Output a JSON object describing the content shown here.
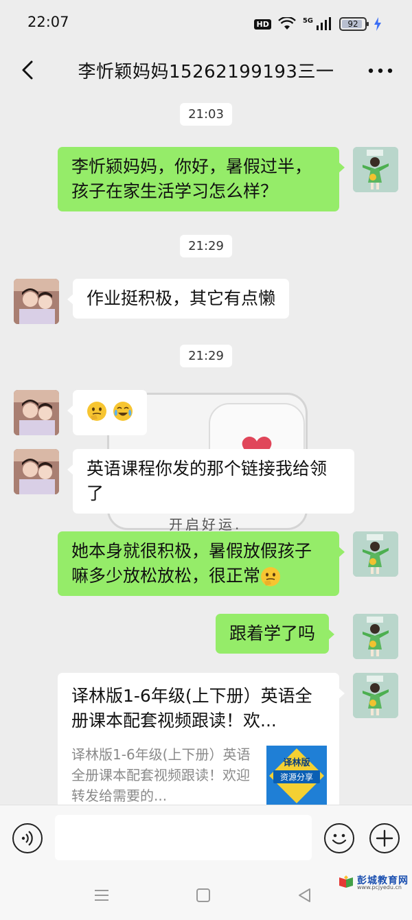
{
  "status_bar": {
    "time": "22:07",
    "hd": "HD",
    "network": "5G",
    "battery_level": "92",
    "battery_fraction": 0.92
  },
  "header": {
    "title": "李忻颖妈妈15262199193三一",
    "back_icon": "chevron-left-icon",
    "more_icon": "more-dots-icon"
  },
  "messages": [
    {
      "type": "timestamp",
      "text": "21:03"
    },
    {
      "type": "out",
      "text": "李忻颍妈妈，你好，暑假过半，孩子在家生活学习怎么样？"
    },
    {
      "type": "timestamp",
      "text": "21:29"
    },
    {
      "type": "in",
      "text": "作业挺积极，其它有点懒"
    },
    {
      "type": "timestamp",
      "text": "21:29"
    },
    {
      "type": "in",
      "emoji": [
        "thinking-face",
        "laughing-crying-face"
      ]
    },
    {
      "type": "in",
      "text": "英语课程你发的那个链接我给领了"
    },
    {
      "type": "out",
      "text": "她本身就很积极，暑假放假孩子嘛多少放松放松，很正常"
    },
    {
      "type": "out",
      "text": "跟着学了吗"
    },
    {
      "type": "link",
      "title": "译林版1-6年级(上下册）英语全册课本配套视频跟读！欢...",
      "desc": "译林版1-6年级(上下册）英语全册课本配套视频跟读！欢迎转发给需要的...",
      "thumb_title": "译林版",
      "thumb_sub": "资源分享"
    }
  ],
  "background_caption": "开启好运.",
  "input": {
    "placeholder": "",
    "value": ""
  },
  "watermark": {
    "text": "彭城教育网",
    "url": "www.pcjyedu.cn"
  },
  "colors": {
    "outgoing_bubble": "#95ec69",
    "incoming_bubble": "#ffffff",
    "chat_bg": "#ededed"
  }
}
